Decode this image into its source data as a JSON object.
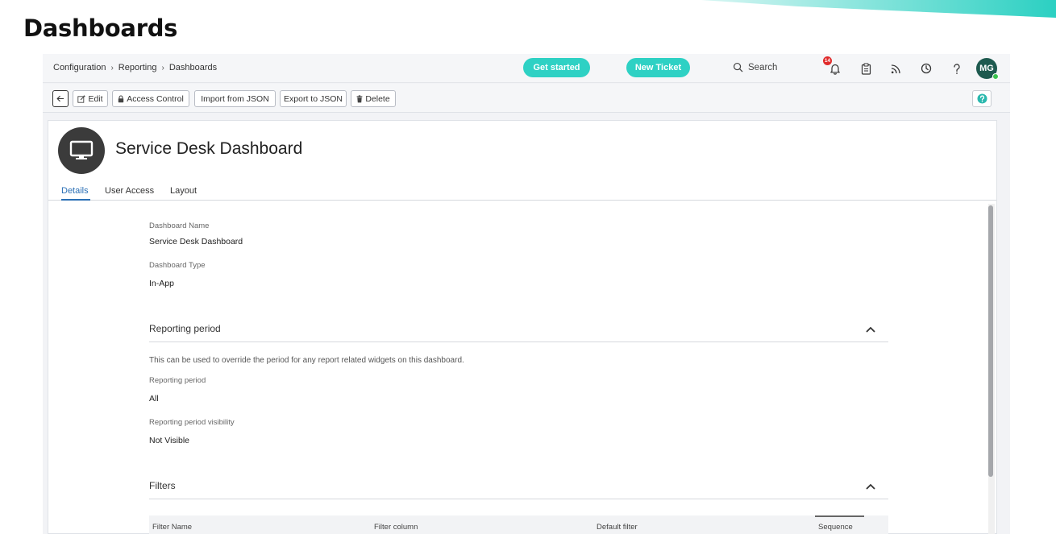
{
  "slide": {
    "title": "Dashboards"
  },
  "breadcrumb": [
    "Configuration",
    "Reporting",
    "Dashboards"
  ],
  "topbar": {
    "get_started": "Get started",
    "new_ticket": "New Ticket",
    "search_label": "Search",
    "notification_count": "14",
    "avatar_initials": "MG",
    "icons": [
      "bell-icon",
      "clipboard-icon",
      "rss-icon",
      "clock-icon",
      "help-icon"
    ]
  },
  "toolbar": {
    "edit": "Edit",
    "access_control": "Access Control",
    "import_json": "Import from JSON",
    "export_json": "Export to JSON",
    "delete": "Delete"
  },
  "dashboard": {
    "title": "Service Desk Dashboard"
  },
  "tabs": [
    "Details",
    "User Access",
    "Layout"
  ],
  "details": {
    "name_label": "Dashboard Name",
    "name_value": "Service Desk Dashboard",
    "type_label": "Dashboard Type",
    "type_value": "In-App"
  },
  "reporting": {
    "section_title": "Reporting period",
    "description": "This can be used to override the period for any report related widgets on this dashboard.",
    "period_label": "Reporting period",
    "period_value": "All",
    "visibility_label": "Reporting period visibility",
    "visibility_value": "Not Visible"
  },
  "filters": {
    "section_title": "Filters",
    "columns": [
      "Filter Name",
      "Filter column",
      "Default filter",
      "Sequence"
    ]
  },
  "colors": {
    "accent": "#2ed1c4",
    "tab_active": "#2a6fb5",
    "badge": "#e02b2b",
    "avatar": "#1e5a4f"
  }
}
